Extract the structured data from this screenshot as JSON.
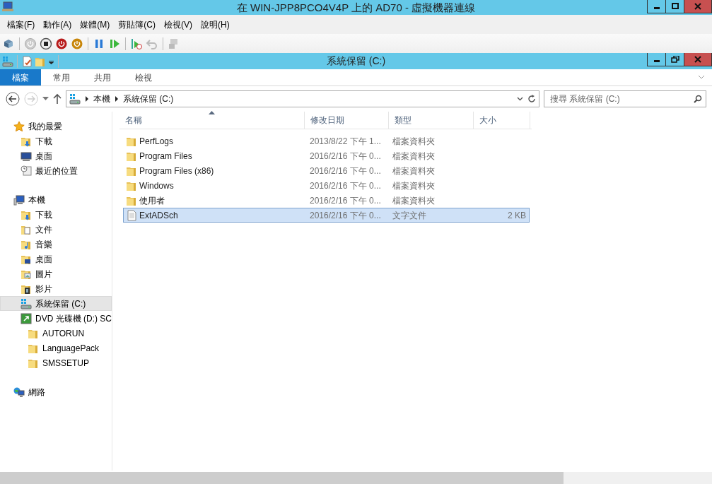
{
  "vm_window": {
    "title": "在 WIN-JPP8PCO4V4P 上的 AD70 - 虛擬機器連線"
  },
  "menu_bar": [
    "檔案(F)",
    "動作(A)",
    "媒體(M)",
    "剪貼簿(C)",
    "檢視(V)",
    "說明(H)"
  ],
  "explorer_window": {
    "title": "系統保留 (C:)"
  },
  "ribbon_tabs": [
    {
      "label": "檔案",
      "kind": "file-menu",
      "selected": false
    },
    {
      "label": "常用",
      "kind": "tab",
      "selected": false
    },
    {
      "label": "共用",
      "kind": "tab",
      "selected": false
    },
    {
      "label": "檢視",
      "kind": "tab",
      "selected": false
    }
  ],
  "address_bar": {
    "path": [
      "本機",
      "系統保留 (C:)"
    ]
  },
  "search": {
    "placeholder": "搜尋 系統保留 (C:)"
  },
  "nav_tree": [
    {
      "label": "我的最愛",
      "kind": "star",
      "selected": false,
      "children": [
        {
          "label": "下載",
          "kind": "downloads",
          "selected": false
        },
        {
          "label": "桌面",
          "kind": "monitor",
          "selected": false
        },
        {
          "label": "最近的位置",
          "kind": "recent",
          "selected": false
        }
      ]
    },
    {
      "label": "本機",
      "kind": "computer",
      "selected": false,
      "children": [
        {
          "label": "下載",
          "kind": "downloads",
          "selected": false
        },
        {
          "label": "文件",
          "kind": "documents",
          "selected": false
        },
        {
          "label": "音樂",
          "kind": "music",
          "selected": false
        },
        {
          "label": "桌面",
          "kind": "desktop",
          "selected": false
        },
        {
          "label": "圖片",
          "kind": "pictures",
          "selected": false
        },
        {
          "label": "影片",
          "kind": "videos",
          "selected": false
        },
        {
          "label": "系統保留 (C:)",
          "kind": "drive",
          "selected": true
        },
        {
          "label": "DVD 光碟機 (D:) SC",
          "kind": "dvd",
          "selected": false,
          "children": [
            {
              "label": "AUTORUN",
              "kind": "folder",
              "selected": false
            },
            {
              "label": "LanguagePack",
              "kind": "folder",
              "selected": false
            },
            {
              "label": "SMSSETUP",
              "kind": "folder",
              "selected": false
            }
          ]
        }
      ]
    },
    {
      "label": "網路",
      "kind": "network",
      "selected": false
    }
  ],
  "file_list": {
    "columns": [
      {
        "label": "名稱",
        "sorted": true
      },
      {
        "label": "修改日期"
      },
      {
        "label": "類型"
      },
      {
        "label": "大小"
      }
    ],
    "rows": [
      {
        "name": "PerfLogs",
        "date": "2013/8/22 下午 1...",
        "type": "檔案資料夾",
        "kind": "folder",
        "selected": false
      },
      {
        "name": "Program Files",
        "date": "2016/2/16 下午 0...",
        "type": "檔案資料夾",
        "kind": "folder",
        "selected": false
      },
      {
        "name": "Program Files (x86)",
        "date": "2016/2/16 下午 0...",
        "type": "檔案資料夾",
        "kind": "folder",
        "selected": false
      },
      {
        "name": "Windows",
        "date": "2016/2/16 下午 0...",
        "type": "檔案資料夾",
        "kind": "folder",
        "selected": false
      },
      {
        "name": "使用者",
        "date": "2016/2/16 下午 0...",
        "type": "檔案資料夾",
        "kind": "folder",
        "selected": false
      },
      {
        "name": "ExtADSch",
        "date": "2016/2/16 下午 0...",
        "type": "文字文件",
        "size": "2 KB",
        "kind": "file",
        "selected": true
      }
    ]
  }
}
